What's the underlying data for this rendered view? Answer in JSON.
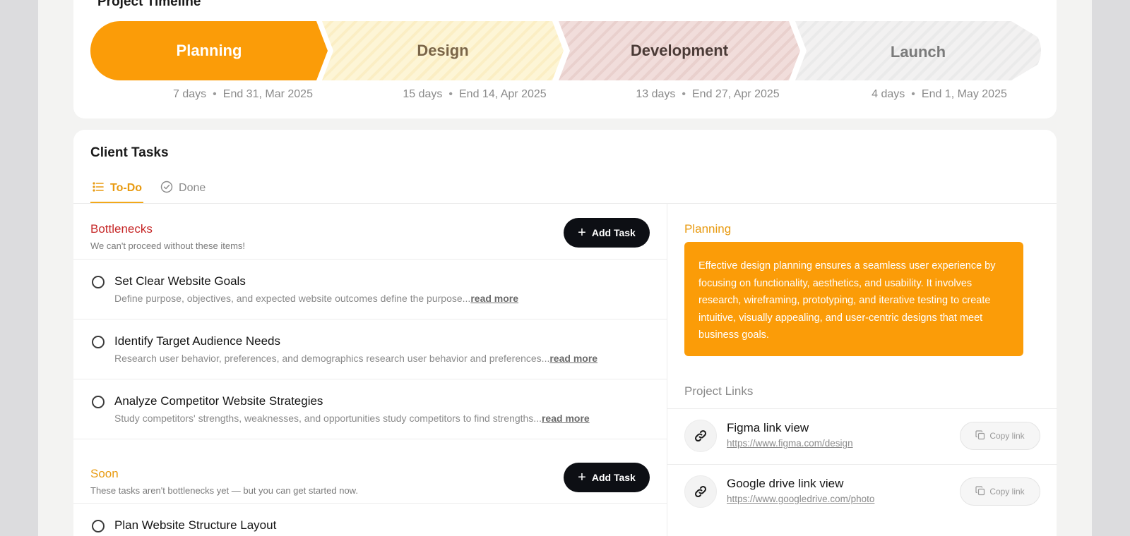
{
  "timeline": {
    "title": "Project Timeline",
    "stages": [
      {
        "name": "Planning",
        "duration": "7 days",
        "end": "End 31, Mar 2025"
      },
      {
        "name": "Design",
        "duration": "15 days",
        "end": "End 14, Apr 2025"
      },
      {
        "name": "Development",
        "duration": "13 days",
        "end": "End 27, Apr 2025"
      },
      {
        "name": "Launch",
        "duration": "4 days",
        "end": "End 1, May 2025"
      }
    ],
    "separator": "•"
  },
  "tasks": {
    "title": "Client Tasks",
    "tabs": [
      {
        "label": "To-Do",
        "icon": "list-icon",
        "active": true
      },
      {
        "label": "Done",
        "icon": "check-circle-icon",
        "active": false
      }
    ],
    "add_task_label": "Add Task",
    "read_more": "read more",
    "sections": [
      {
        "title": "Bottlenecks",
        "subtitle": "We can't proceed without these items!",
        "color": "#c62828",
        "items": [
          {
            "title": "Set Clear Website Goals",
            "desc": "Define purpose, objectives, and expected website outcomes define the purpose..."
          },
          {
            "title": "Identify Target Audience Needs",
            "desc": "Research user behavior, preferences, and demographics research user behavior and preferences..."
          },
          {
            "title": "Analyze Competitor Website Strategies",
            "desc": "Study competitors' strengths, weaknesses, and opportunities study competitors to find strengths..."
          }
        ]
      },
      {
        "title": "Soon",
        "subtitle": "These tasks aren't bottlenecks yet — but you can get started now.",
        "color": "#e89a10",
        "items": [
          {
            "title": "Plan Website Structure Layout",
            "desc": ""
          }
        ]
      }
    ]
  },
  "planning": {
    "title": "Planning",
    "description": "Effective design planning ensures a seamless user experience by focusing on functionality, aesthetics, and usability. It involves research, wireframing, prototyping, and iterative testing to create intuitive, visually appealing, and user-centric designs that meet business goals."
  },
  "links": {
    "title": "Project Links",
    "copy_label": "Copy link",
    "items": [
      {
        "name": "Figma link view",
        "url": "https://www.figma.com/design"
      },
      {
        "name": "Google drive link view",
        "url": "https://www.googledrive.com/photo"
      }
    ]
  },
  "colors": {
    "accent": "#fb9c08",
    "danger": "#c62828",
    "button_dark": "#0d0f14"
  }
}
